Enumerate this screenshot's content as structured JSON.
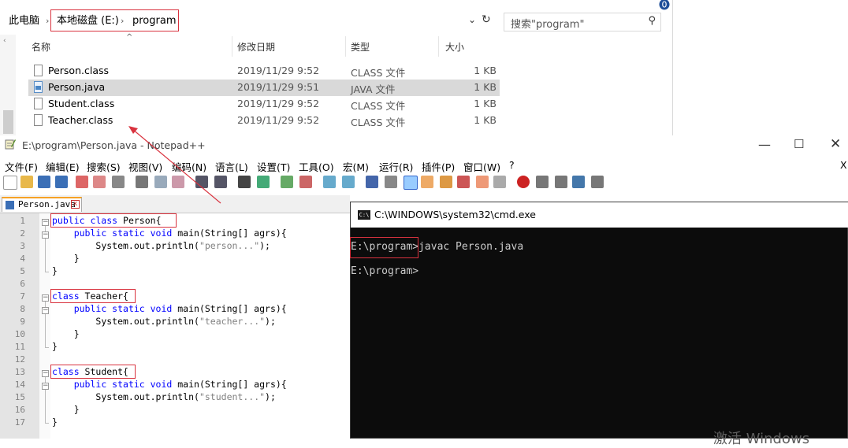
{
  "explorer": {
    "breadcrumbs": [
      "此电脑",
      "本地磁盘 (E:)",
      "program"
    ],
    "search_placeholder": "搜索\"program\"",
    "columns": [
      "名称",
      "修改日期",
      "类型",
      "大小"
    ],
    "files": [
      {
        "name": "Person.class",
        "date": "2019/11/29 9:52",
        "type": "CLASS 文件",
        "size": "1 KB",
        "selected": false,
        "icon": "class-file-icon"
      },
      {
        "name": "Person.java",
        "date": "2019/11/29 9:51",
        "type": "JAVA 文件",
        "size": "1 KB",
        "selected": true,
        "icon": "java-file-icon"
      },
      {
        "name": "Student.class",
        "date": "2019/11/29 9:52",
        "type": "CLASS 文件",
        "size": "1 KB",
        "selected": false,
        "icon": "class-file-icon"
      },
      {
        "name": "Teacher.class",
        "date": "2019/11/29 9:52",
        "type": "CLASS 文件",
        "size": "1 KB",
        "selected": false,
        "icon": "class-file-icon"
      }
    ],
    "selection_color": "#d9d9d9"
  },
  "notepad": {
    "title": "E:\\program\\Person.java - Notepad++",
    "menu": [
      "文件(F)",
      "编辑(E)",
      "搜索(S)",
      "视图(V)",
      "编码(N)",
      "语言(L)",
      "设置(T)",
      "工具(O)",
      "宏(M)",
      "运行(R)",
      "插件(P)",
      "窗口(W)",
      "?"
    ],
    "close_glyph": "X",
    "tab_label": "Person.java",
    "line_numbers": [
      "1",
      "2",
      "3",
      "4",
      "5",
      "6",
      "7",
      "8",
      "9",
      "10",
      "11",
      "12",
      "13",
      "14",
      "15",
      "16",
      "17"
    ],
    "code": {
      "l1_kw": "public class",
      "l1_name": " Person",
      "l1_brace": "{",
      "l2": "public static void",
      "l2_rest": " main(String[] agrs){",
      "l3": "System.out.println(",
      "l3_str": "\"person...\"",
      "l3_end": ");",
      "close_inner": "}",
      "close_outer": "}",
      "l7_kw": "class",
      "l7_name": " Teacher",
      "l9_str": "\"teacher...\"",
      "l13_kw": "class",
      "l13_name": " Student",
      "l15_str": "\"student...\""
    },
    "keyword_color": "#0000ff",
    "string_color": "#808080"
  },
  "cmd": {
    "title": "C:\\WINDOWS\\system32\\cmd.exe",
    "icon_text": "C:\\",
    "prompt": "E:\\program>",
    "command": "javac Person.java",
    "prompt2": "E:\\program>"
  },
  "annotation_color": "#d9333f",
  "watermark": "激活 Windows"
}
